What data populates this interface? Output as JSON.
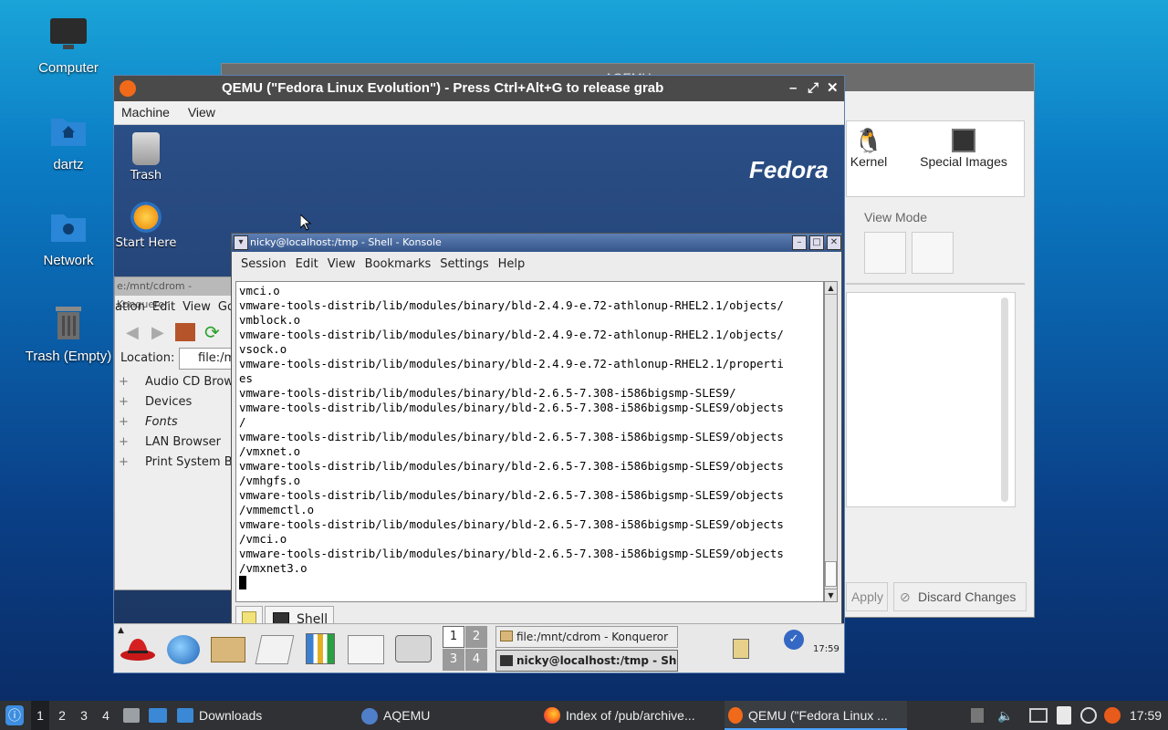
{
  "desktop": {
    "icons": [
      {
        "label": "Computer"
      },
      {
        "label": "dartz"
      },
      {
        "label": "Network"
      },
      {
        "label": "Trash (Empty)"
      }
    ]
  },
  "aqemu": {
    "title": "AQEMU",
    "kernel_label": "Kernel",
    "special_images_label": "Special Images",
    "view_mode_label": "View Mode",
    "apply_label": "Apply",
    "discard_label": "Discard Changes"
  },
  "qemu": {
    "title": "QEMU (\"Fedora Linux Evolution\") - Press Ctrl+Alt+G to release grab",
    "menu": [
      "Machine",
      "View"
    ]
  },
  "guest": {
    "brand": "Fedora",
    "icons": [
      {
        "label": "Trash"
      },
      {
        "label": "Start Here"
      }
    ],
    "konqueror": {
      "title": "e:/mnt/cdrom - Konqueror",
      "menu": [
        "ation",
        "Edit",
        "View",
        "Go"
      ],
      "location_label": "Location:",
      "location_value": "file:/m",
      "tree": [
        "Audio CD Brows",
        "Devices",
        "Fonts",
        "LAN Browser",
        "Print System Br"
      ]
    },
    "konsole": {
      "title": "nicky@localhost:/tmp - Shell - Konsole",
      "menu": [
        "Session",
        "Edit",
        "View",
        "Bookmarks",
        "Settings",
        "Help"
      ],
      "lines": [
        "vmci.o",
        "vmware-tools-distrib/lib/modules/binary/bld-2.4.9-e.72-athlonup-RHEL2.1/objects/",
        "vmblock.o",
        "vmware-tools-distrib/lib/modules/binary/bld-2.4.9-e.72-athlonup-RHEL2.1/objects/",
        "vsock.o",
        "vmware-tools-distrib/lib/modules/binary/bld-2.4.9-e.72-athlonup-RHEL2.1/properti",
        "es",
        "vmware-tools-distrib/lib/modules/binary/bld-2.6.5-7.308-i586bigsmp-SLES9/",
        "vmware-tools-distrib/lib/modules/binary/bld-2.6.5-7.308-i586bigsmp-SLES9/objects",
        "/",
        "vmware-tools-distrib/lib/modules/binary/bld-2.6.5-7.308-i586bigsmp-SLES9/objects",
        "/vmxnet.o",
        "vmware-tools-distrib/lib/modules/binary/bld-2.6.5-7.308-i586bigsmp-SLES9/objects",
        "/vmhgfs.o",
        "vmware-tools-distrib/lib/modules/binary/bld-2.6.5-7.308-i586bigsmp-SLES9/objects",
        "/vmmemctl.o",
        "vmware-tools-distrib/lib/modules/binary/bld-2.6.5-7.308-i586bigsmp-SLES9/objects",
        "/vmci.o",
        "vmware-tools-distrib/lib/modules/binary/bld-2.6.5-7.308-i586bigsmp-SLES9/objects",
        "/vmxnet3.o"
      ],
      "tab_label": "Shell"
    },
    "panel": {
      "desktops": [
        "1",
        "2",
        "3",
        "4"
      ],
      "tasks": [
        "file:/mnt/cdrom - Konqueror",
        "nicky@localhost:/tmp - She"
      ],
      "clock": "17:59"
    }
  },
  "taskbar": {
    "workspaces": [
      "1",
      "2",
      "3",
      "4"
    ],
    "items": [
      "Downloads",
      "AQEMU",
      "Index of /pub/archive...",
      "QEMU (\"Fedora Linux ..."
    ],
    "clock": "17:59"
  },
  "colors": {
    "konsole_title": "#35558a",
    "taskbar": "#2f3134",
    "active_task_underline": "#4aa3ff"
  }
}
